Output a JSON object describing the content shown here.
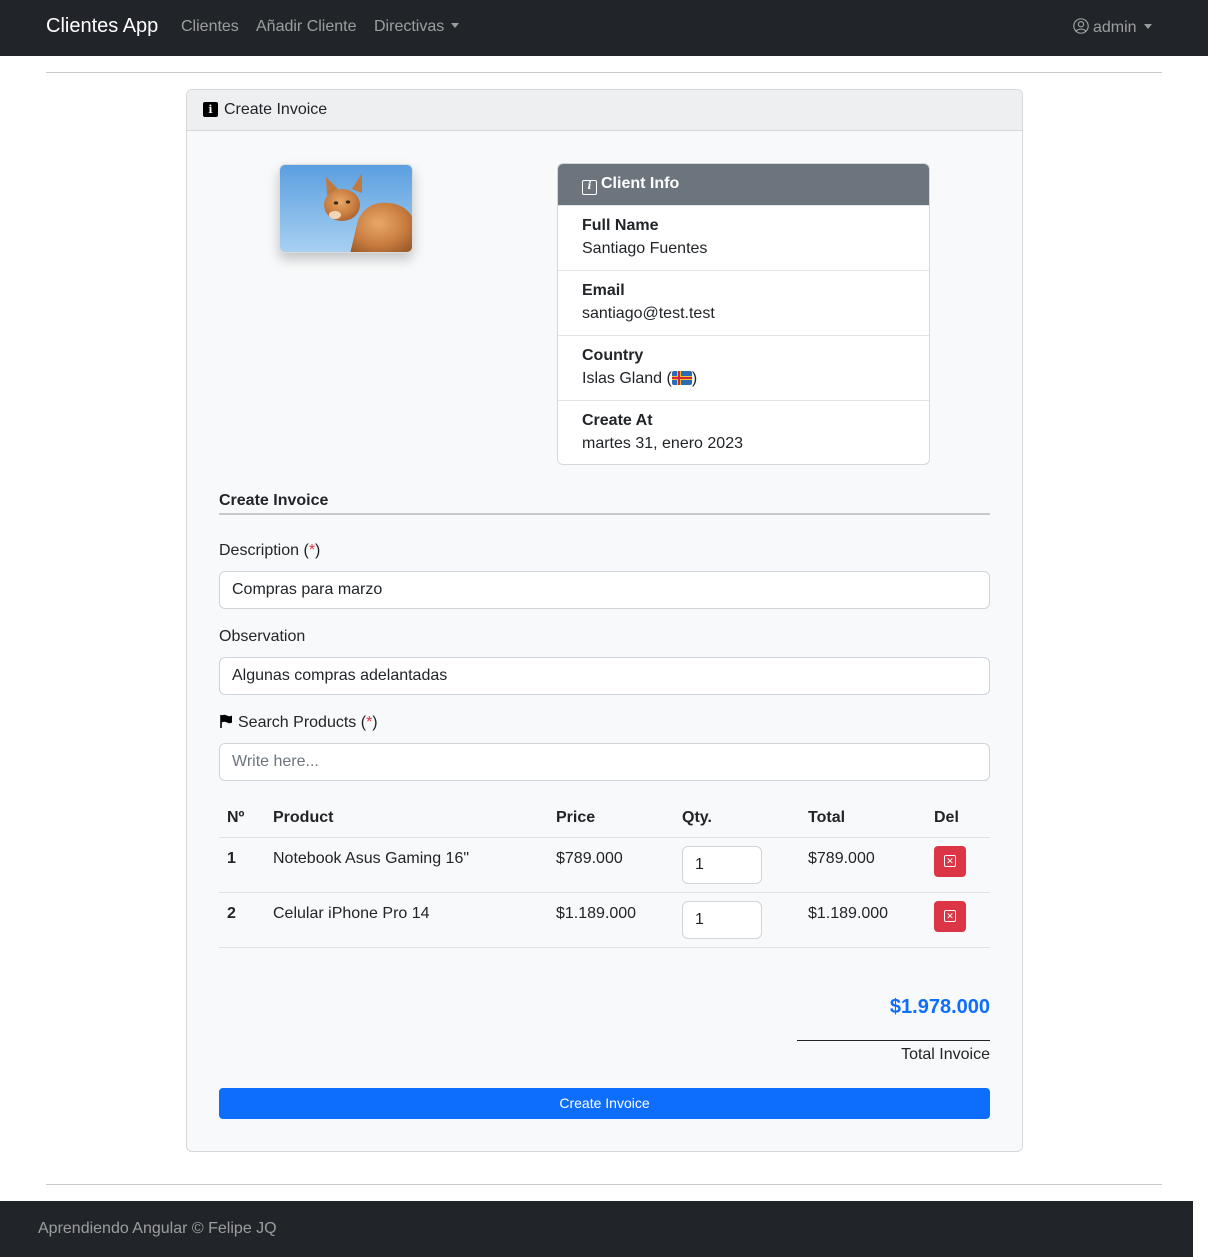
{
  "navbar": {
    "brand": "Clientes App",
    "links": [
      "Clientes",
      "Añadir Cliente",
      "Directivas"
    ],
    "user": "admin"
  },
  "card": {
    "header_title": "Create Invoice"
  },
  "client_info": {
    "title": "Client Info",
    "fields": [
      {
        "label": "Full Name",
        "value": "Santiago Fuentes"
      },
      {
        "label": "Email",
        "value": "santiago@test.test"
      },
      {
        "label": "Country",
        "value_prefix": "Islas Gland (",
        "value_suffix": ")"
      },
      {
        "label": "Create At",
        "value": "martes 31, enero 2023"
      }
    ]
  },
  "form": {
    "section_title": "Create Invoice",
    "description_label": "Description (",
    "required_mark": "*",
    "label_close": ")",
    "description_value": "Compras para marzo",
    "observation_label": "Observation",
    "observation_value": "Algunas compras adelantadas",
    "search_label": "Search Products (",
    "search_placeholder": "Write here..."
  },
  "table": {
    "headers": [
      "Nº",
      "Product",
      "Price",
      "Qty.",
      "Total",
      "Del"
    ],
    "rows": [
      {
        "n": "1",
        "product": "Notebook Asus Gaming 16\"",
        "price": "$789.000",
        "qty": "1",
        "total": "$789.000"
      },
      {
        "n": "2",
        "product": "Celular iPhone Pro 14",
        "price": "$1.189.000",
        "qty": "1",
        "total": "$1.189.000"
      }
    ]
  },
  "summary": {
    "grand_total": "$1.978.000",
    "total_label": "Total Invoice",
    "submit_label": "Create Invoice"
  },
  "footer": {
    "text": "Aprendiendo Angular © Felipe JQ"
  },
  "colors": {
    "navbar_bg": "#212529",
    "primary": "#0d6efd",
    "danger": "#dc3545",
    "secondary": "#6c757d"
  }
}
